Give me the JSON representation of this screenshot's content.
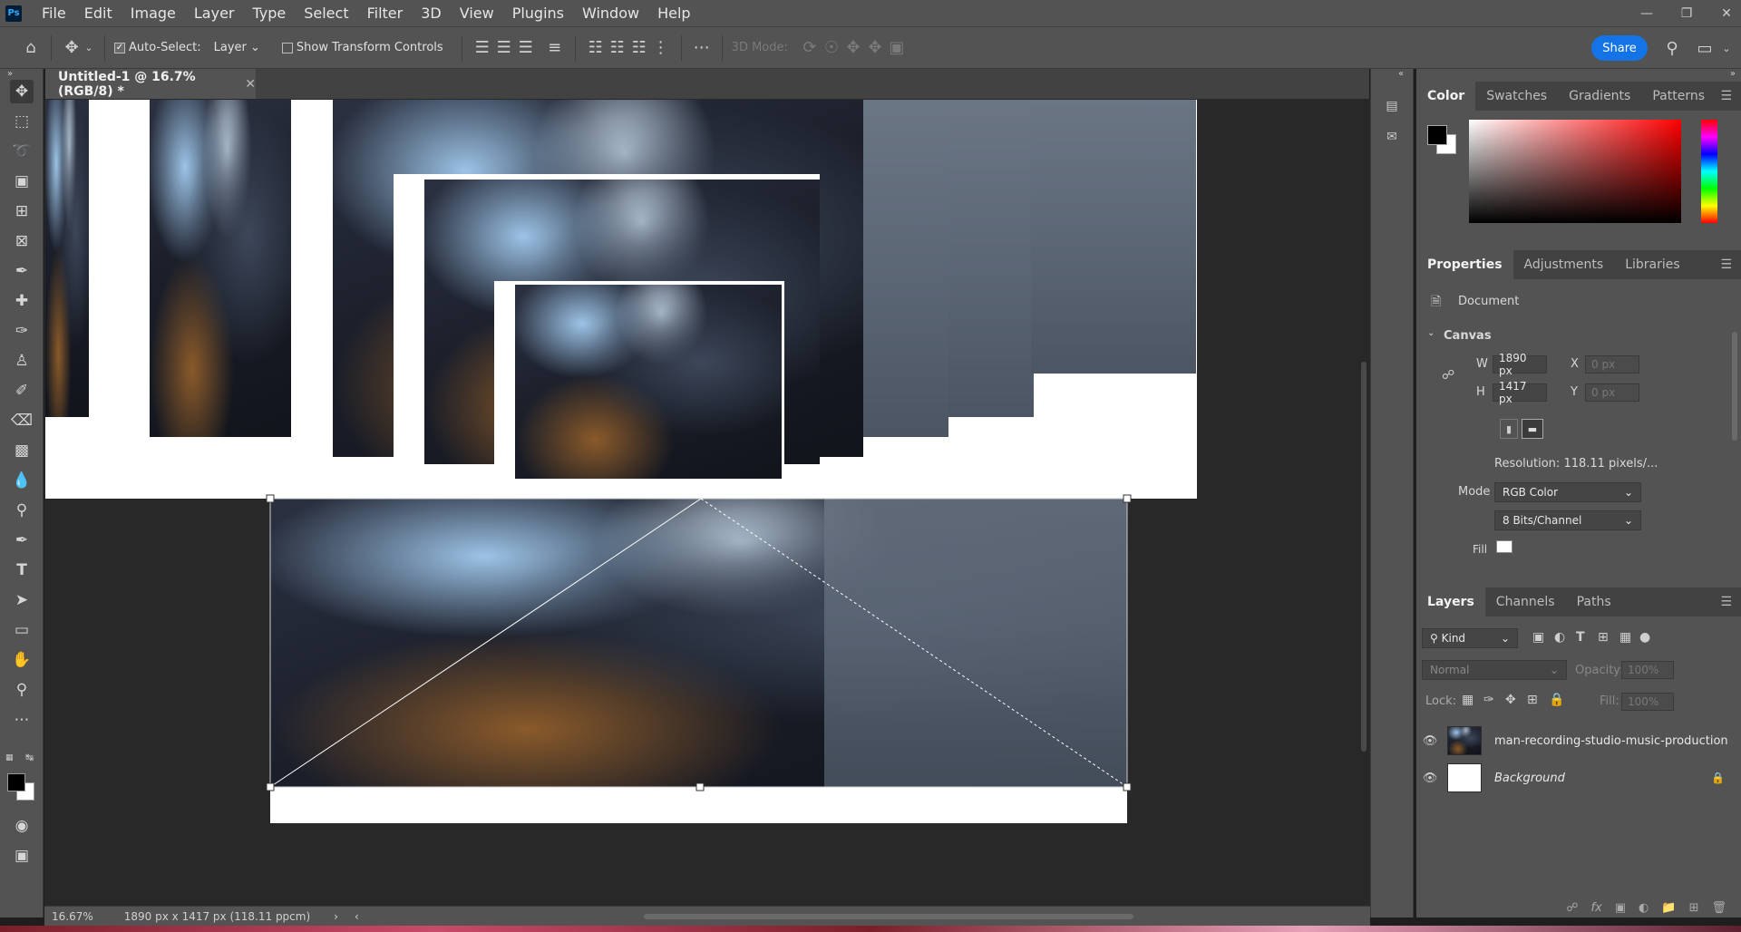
{
  "app": {
    "logo": "Ps"
  },
  "menu": [
    "File",
    "Edit",
    "Image",
    "Layer",
    "Type",
    "Select",
    "Filter",
    "3D",
    "View",
    "Plugins",
    "Window",
    "Help"
  ],
  "options": {
    "auto_select_label": "Auto-Select:",
    "auto_select_target": "Layer",
    "show_transform_label": "Show Transform Controls",
    "mode_3d_label": "3D Mode:",
    "share_label": "Share"
  },
  "document": {
    "tab_title": "Untitled-1 @ 16.7% (RGB/8) *"
  },
  "status": {
    "zoom": "16.67%",
    "info": "1890 px x 1417 px (118.11 ppcm)"
  },
  "panels": {
    "color_tabs": [
      "Color",
      "Swatches",
      "Gradients",
      "Patterns"
    ],
    "properties_tabs": [
      "Properties",
      "Adjustments",
      "Libraries"
    ],
    "properties": {
      "type_label": "Document",
      "section": "Canvas",
      "w_label": "W",
      "w_value": "1890 px",
      "h_label": "H",
      "h_value": "1417 px",
      "x_label": "X",
      "x_placeholder": "0 px",
      "y_label": "Y",
      "y_placeholder": "0 px",
      "resolution": "Resolution: 118.11 pixels/...",
      "mode_label": "Mode",
      "mode_value": "RGB Color",
      "bits_value": "8 Bits/Channel",
      "fill_label": "Fill"
    },
    "layers_tabs": [
      "Layers",
      "Channels",
      "Paths"
    ],
    "layers_filter": "Kind",
    "blend_mode": "Normal",
    "opacity_label": "Opacity:",
    "opacity_value": "100%",
    "lock_label": "Lock:",
    "fill_label": "Fill:",
    "fill_value": "100%",
    "layers": [
      {
        "name": "man-recording-studio-music-production"
      },
      {
        "name": "Background"
      }
    ]
  },
  "colors": {
    "accent": "#1473e6",
    "foreground": "#000000",
    "background": "#ffffff"
  }
}
